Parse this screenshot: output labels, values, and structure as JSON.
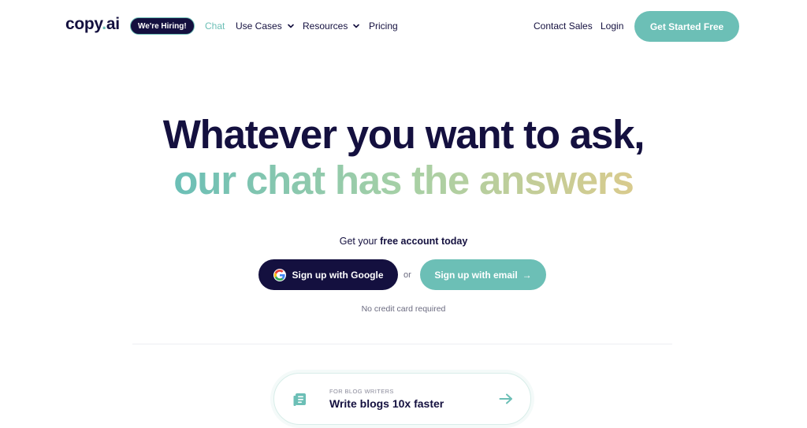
{
  "nav": {
    "logo_text": "copy",
    "logo_dot": ".",
    "logo_suffix": "ai",
    "hiring_badge": "We're Hiring!",
    "items": [
      {
        "label": "Chat",
        "active": true
      },
      {
        "label": "Use Cases",
        "has_dropdown": true
      },
      {
        "label": "Resources",
        "has_dropdown": true
      },
      {
        "label": "Pricing"
      }
    ],
    "contact_sales": "Contact Sales",
    "login": "Login",
    "cta": "Get Started Free"
  },
  "hero": {
    "line1": "Whatever you want to ask,",
    "line2": "our chat has the answers",
    "account_prefix": "Get your ",
    "account_bold": "free account today",
    "google_button": "Sign up with Google",
    "or": "or",
    "email_button": "Sign up with email",
    "email_arrow": "→",
    "no_credit_card": "No credit card required"
  },
  "feature_card": {
    "kicker": "FOR BLOG WRITERS",
    "title": "Write blogs 10x faster",
    "icon": "document-icon",
    "arrow_icon": "arrow-right-icon"
  },
  "colors": {
    "navy": "#14103f",
    "teal": "#6cbfb6",
    "gradient_end": "#d8cb8e"
  }
}
